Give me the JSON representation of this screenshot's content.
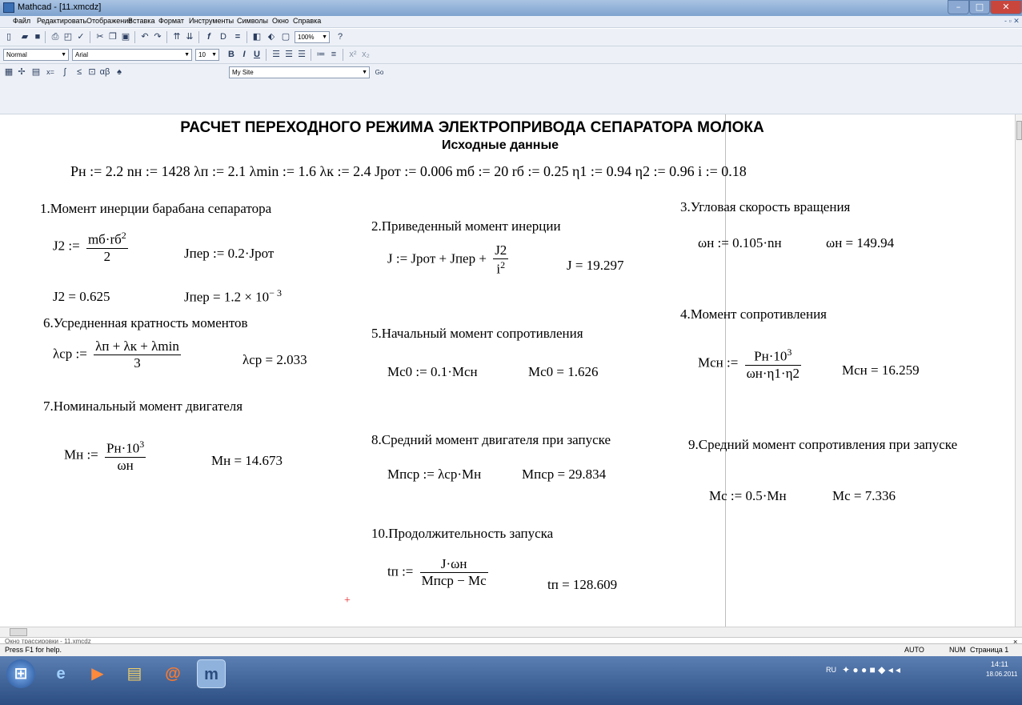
{
  "window": {
    "title": "Mathcad - [11.xmcdz]"
  },
  "menu": [
    "Файл",
    "Редактировать",
    "Отображение",
    "Вставка",
    "Формат",
    "Инструменты",
    "Символы",
    "Окно",
    "Справка"
  ],
  "toolbar": {
    "zoom": "100%",
    "style": "Normal",
    "font": "Arial",
    "size": "10",
    "site": "My Site",
    "go": "Go"
  },
  "doc": {
    "title": "РАСЧЕТ ПЕРЕХОДНОГО РЕЖИМА ЭЛЕКТРОПРИВОДА СЕПАРАТОРА МОЛОКА",
    "subtitle": "Исходные данные",
    "inputs": "Pн := 2.2   nн := 1428   λп := 2.1   λmin := 1.6    λк := 2.4    Jрот := 0.006    mб := 20   rб := 0.25   η1 := 0.94    η2 := 0.96    i := 0.18",
    "s1": "1.Момент инерции барабана сепаратора",
    "s2": "2.Приведенный момент инерции",
    "s3": "3.Угловая скорость вращения",
    "s4": "4.Момент сопротивления",
    "s5": "5.Начальный момент сопротивления",
    "s6": "6.Усредненная кратность моментов",
    "s7": "7.Номинальный момент двигателя",
    "s8": "8.Средний момент двигателя при запуске",
    "s9": "9.Средний момент сопротивления при запуске",
    "s10": "10.Продолжительность запуска",
    "j2_def_lhs": "J2 :=",
    "j2_num": "mб·rб",
    "j2_den": "2",
    "jper_def": "Jпер := 0.2·Jрот",
    "j2_res": "J2 = 0.625",
    "jper_res": "Jпер = 1.2 × 10",
    "jper_exp": "− 3",
    "j_def_lhs": "J := Jрот + Jпер +",
    "j_num": "J2",
    "j_den": "i",
    "j_res": "J = 19.297",
    "wn_def": "ωн := 0.105·nн",
    "wn_res": "ωн = 149.94",
    "mcn_lhs": "Mcн :=",
    "mcn_num": "Pн·10",
    "mcn_den": "ωн·η1·η2",
    "mcn_res": "Mcн = 16.259",
    "mc0_def": "Mc0 := 0.1·Mcн",
    "mc0_res": "Mc0 = 1.626",
    "lcp_lhs": "λcр :=",
    "lcp_num": "λп + λк + λmin",
    "lcp_den": "3",
    "lcp_res": "λcр = 2.033",
    "mn_lhs": "Mн :=",
    "mn_num": "Pн·10",
    "mn_den": "ωн",
    "mn_res": "Mн = 14.673",
    "mpcp_def": "Mпcр := λcр·Mн",
    "mpcp_res": "Mпcр = 29.834",
    "mc_def": "Mc := 0.5·Mн",
    "mc_res": "Mc = 7.336",
    "tp_lhs": "tп :=",
    "tp_num": "J·ωн",
    "tp_den": "Mпcр − Mc",
    "tp_res": "tп = 128.609",
    "exp2": "2",
    "exp3": "3"
  },
  "trace": "Окно трассировки - 11.xmcdz",
  "status": {
    "help": "Press F1 for help.",
    "mode": "AUTO",
    "num": "NUM",
    "page": "Страница 1"
  },
  "tray": {
    "lang": "RU",
    "time": "14:11",
    "date": "18.06.2011"
  }
}
